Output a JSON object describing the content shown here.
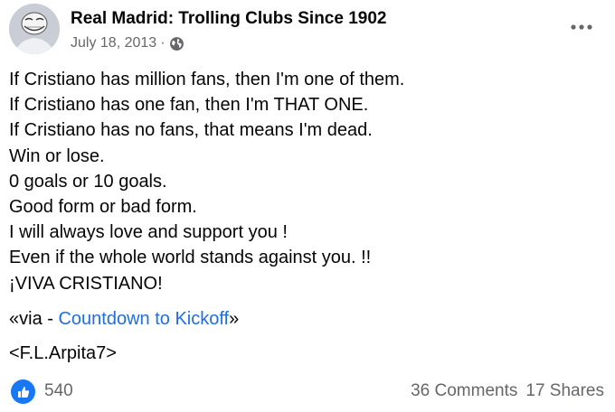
{
  "post": {
    "page_name": "Real Madrid: Trolling Clubs Since 1902",
    "date": "July 18, 2013",
    "separator": "·",
    "privacy_icon": "globe-icon",
    "menu_icon": "more-horizontal-icon",
    "lines": [
      "If Cristiano has million fans, then I'm one of them.",
      "If Cristiano has one fan, then I'm THAT ONE.",
      "If Cristiano has no fans, that means I'm dead.",
      "Win or lose.",
      "0 goals or 10 goals.",
      "Good form or bad form.",
      "I will always love and support you !",
      "Even if the whole world stands against you. !!",
      "¡VIVA CRISTIANO!"
    ],
    "via_prefix": "«via - ",
    "via_link": "Countdown to Kickoff",
    "via_suffix": "»",
    "signature": "<F.L.Arpita7>"
  },
  "footer": {
    "reaction_icon": "like-icon",
    "reaction_count": "540",
    "comments": "36 Comments",
    "shares": "17 Shares"
  },
  "colors": {
    "link": "#216fdb",
    "secondary_text": "#65676b",
    "like_blue": "#1877f2"
  }
}
